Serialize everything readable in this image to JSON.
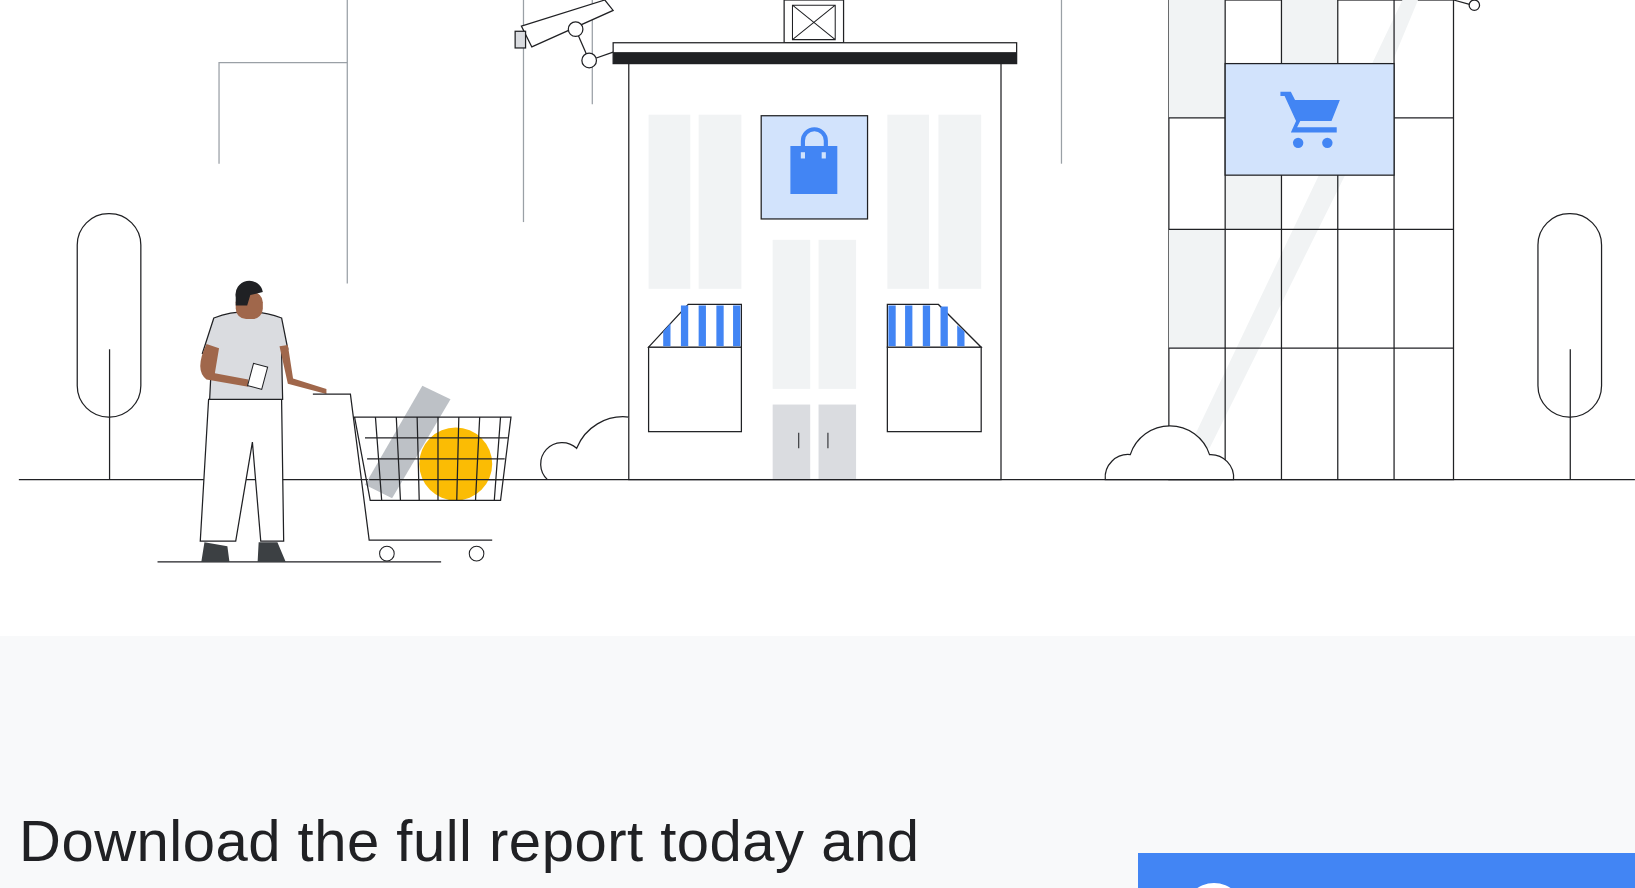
{
  "heading": "Download the full report today and"
}
